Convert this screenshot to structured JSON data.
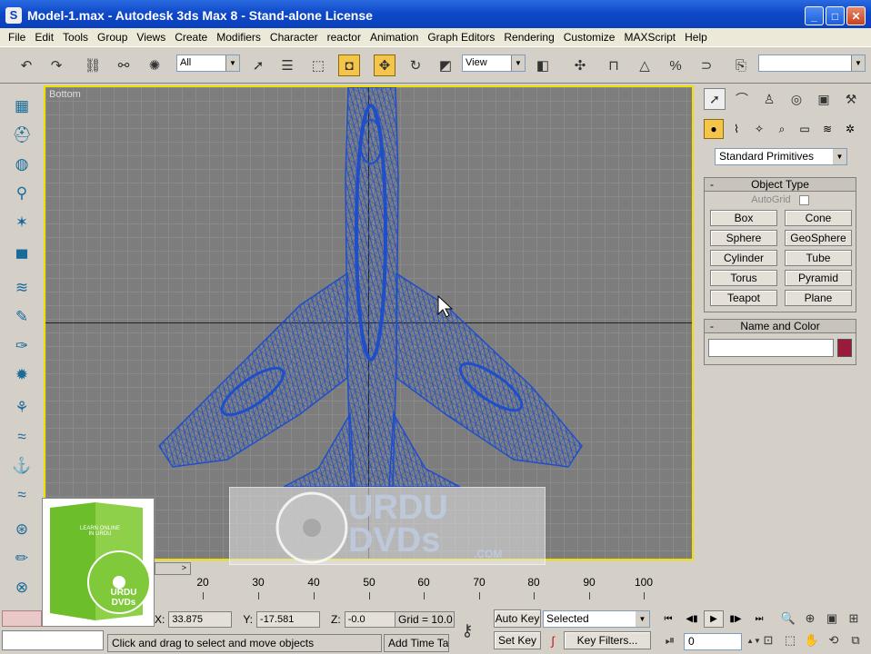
{
  "window": {
    "title": "Model-1.max - Autodesk 3ds Max 8  - Stand-alone License",
    "buttons": {
      "minimize": "_",
      "maximize": "□",
      "close": "✕"
    }
  },
  "menu": [
    "File",
    "Edit",
    "Tools",
    "Group",
    "Views",
    "Create",
    "Modifiers",
    "Character",
    "reactor",
    "Animation",
    "Graph Editors",
    "Rendering",
    "Customize",
    "MAXScript",
    "Help"
  ],
  "toolbar": {
    "selection_filter": "All",
    "reference_coord": "View"
  },
  "viewport": {
    "label": "Bottom",
    "wireframe_color": "#1f4fc8",
    "active_border_color": "#f0e000"
  },
  "command_panel": {
    "category_dropdown": "Standard Primitives",
    "object_type": {
      "header": "Object Type",
      "collapse": "-",
      "autogrid_label": "AutoGrid",
      "buttons": [
        "Box",
        "Cone",
        "Sphere",
        "GeoSphere",
        "Cylinder",
        "Tube",
        "Torus",
        "Pyramid",
        "Teapot",
        "Plane"
      ]
    },
    "name_and_color": {
      "header": "Name and Color",
      "collapse": "-",
      "name_value": "",
      "color": "#9a1a3a"
    }
  },
  "timeline": {
    "ticks": [
      "20",
      "30",
      "40",
      "50",
      "60",
      "70",
      "80",
      "90",
      "100"
    ]
  },
  "status": {
    "x_label": "X:",
    "x_value": "33.875",
    "y_label": "Y:",
    "y_value": "-17.581",
    "z_label": "Z:",
    "z_value": "-0.0",
    "grid": "Grid = 10.0",
    "prompt": "Click and drag to select and move objects",
    "add_time_tag": "Add Time Tag",
    "auto_key": "Auto Key",
    "set_key": "Set Key",
    "key_mode": "Selected",
    "key_filters": "Key Filters...",
    "current_frame": "0"
  },
  "watermark": {
    "line1": "URDU",
    "line2": "DVDs",
    "suffix": ".COM"
  },
  "dvd_box": {
    "text1": "LEARN ONLINE IN URDU",
    "text2": "URDU DVDs"
  }
}
